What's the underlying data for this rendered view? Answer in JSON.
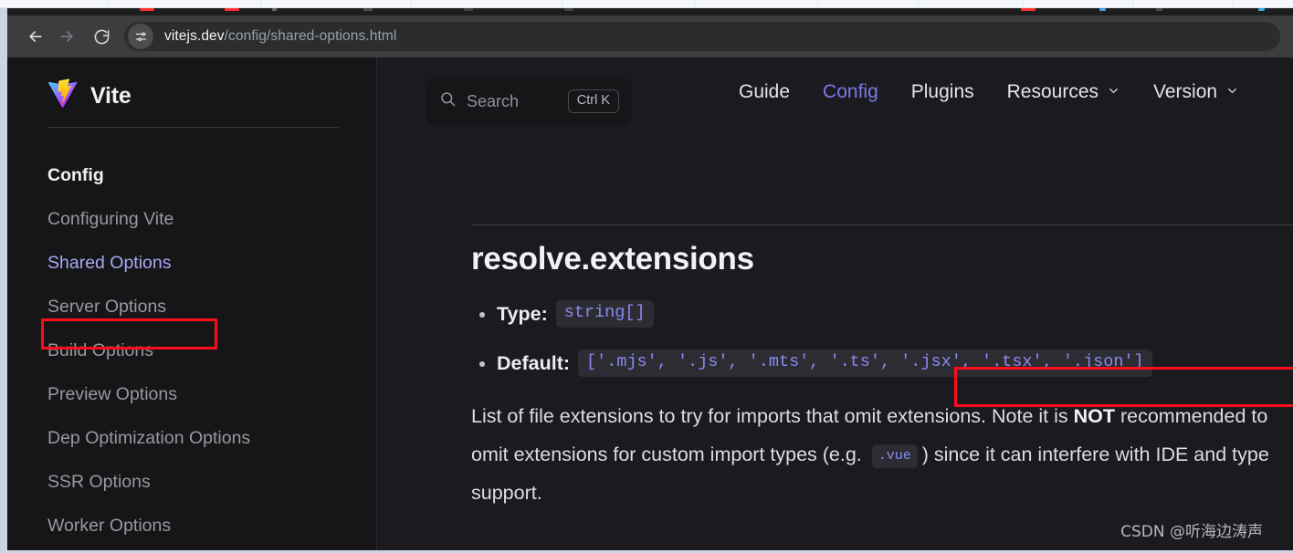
{
  "browser": {
    "back_icon": "back-arrow-icon",
    "forward_icon": "forward-arrow-icon",
    "reload_icon": "reload-icon",
    "site_settings_icon": "tune-sliders-icon",
    "url_host": "vitejs.dev",
    "url_path": "/config/shared-options.html",
    "url_full": "vitejs.dev/config/shared-options.html"
  },
  "sidebar": {
    "brand": {
      "logo_icon": "vite-lightning-logo",
      "name": "Vite"
    },
    "items": [
      {
        "label": "Config",
        "kind": "section"
      },
      {
        "label": "Configuring Vite",
        "kind": "plain"
      },
      {
        "label": "Shared Options",
        "kind": "active"
      },
      {
        "label": "Server Options",
        "kind": "plain"
      },
      {
        "label": "Build Options",
        "kind": "plain"
      },
      {
        "label": "Preview Options",
        "kind": "plain"
      },
      {
        "label": "Dep Optimization Options",
        "kind": "plain"
      },
      {
        "label": "SSR Options",
        "kind": "plain"
      },
      {
        "label": "Worker Options",
        "kind": "plain"
      }
    ]
  },
  "topnav": {
    "search": {
      "icon": "search-icon",
      "label": "Search",
      "shortcut": "Ctrl K"
    },
    "links": [
      {
        "label": "Guide",
        "accent": false,
        "caret": false
      },
      {
        "label": "Config",
        "accent": true,
        "caret": false
      },
      {
        "label": "Plugins",
        "accent": false,
        "caret": false
      },
      {
        "label": "Resources",
        "accent": false,
        "caret": true
      },
      {
        "label": "Version",
        "accent": false,
        "caret": true
      }
    ]
  },
  "article": {
    "heading": "resolve.extensions",
    "type_label": "Type:",
    "type_value": "string[]",
    "default_label": "Default:",
    "default_value": "['.mjs', '.js', '.mts', '.ts', '.jsx', '.tsx', '.json']",
    "paragraph": {
      "part1": "List of file extensions to try for imports that omit extensions. Note it is ",
      "strong1": "NOT",
      "part2": " recommended to omit extensions for custom import types (e.g. ",
      "code1": ".vue",
      "part3": ") since it can interfere with IDE and type support."
    }
  },
  "annotations": {
    "highlight_color": "#fc0d1b",
    "boxes": [
      {
        "name": "sidebar-shared-options-highlight"
      },
      {
        "name": "default-value-highlight"
      }
    ]
  },
  "watermark": {
    "text": "CSDN @听海边涛声"
  },
  "colors": {
    "page_bg": "#1b1b1f",
    "sidebar_bg": "#161618",
    "accent": "#7a7af0",
    "code_text": "#8a8af2",
    "chrome_toolbar": "#3b3d3f"
  }
}
